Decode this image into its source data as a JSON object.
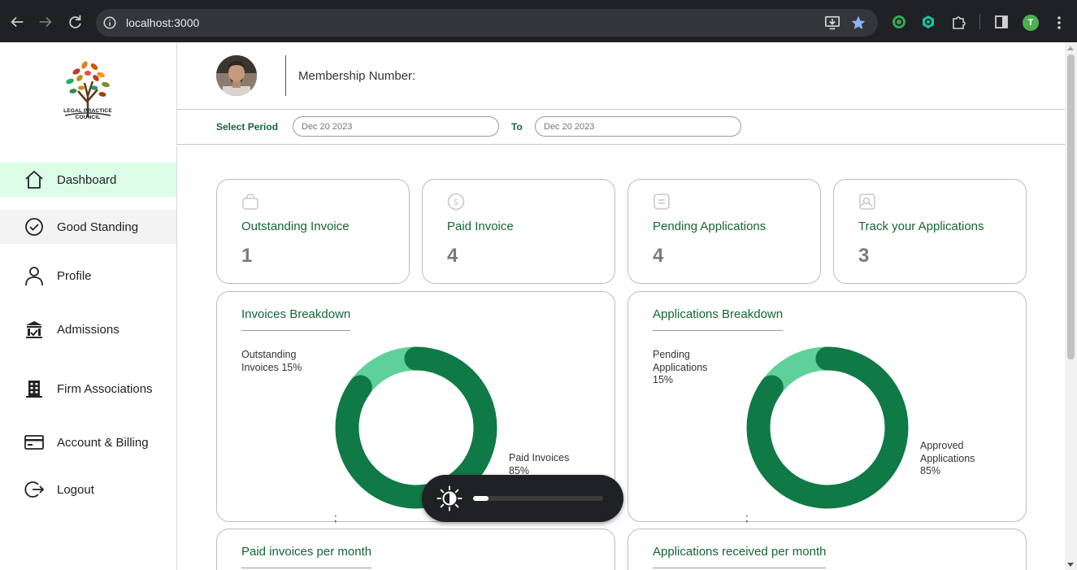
{
  "browser": {
    "url": "localhost:3000",
    "profile_initial": "T"
  },
  "sidebar": {
    "logo_text": "LEGAL PRACTICE COUNCIL",
    "items": [
      {
        "label": "Dashboard",
        "icon": "home-icon"
      },
      {
        "label": "Good Standing",
        "icon": "check-circle-icon"
      },
      {
        "label": "Profile",
        "icon": "user-icon"
      },
      {
        "label": "Admissions",
        "icon": "building-icon"
      },
      {
        "label": "Firm Associations",
        "icon": "office-building-icon"
      },
      {
        "label": "Account & Billing",
        "icon": "credit-card-icon"
      },
      {
        "label": "Logout",
        "icon": "logout-icon"
      }
    ]
  },
  "header": {
    "membership_label": "Membership Number:"
  },
  "period": {
    "select_label": "Select Period",
    "to_label": "To",
    "from_placeholder": "Dec 20 2023",
    "to_placeholder": "Dec 20 2023"
  },
  "stats": [
    {
      "title": "Outstanding Invoice",
      "value": "1",
      "icon": "bag-icon"
    },
    {
      "title": "Paid Invoice",
      "value": "4",
      "icon": "dollar-icon"
    },
    {
      "title": "Pending Applications",
      "value": "4",
      "icon": "document-icon"
    },
    {
      "title": "Track your Applications",
      "value": "3",
      "icon": "image-search-icon"
    }
  ],
  "invoices_panel": {
    "title": "Invoices Breakdown",
    "label_a_line1": "Outstanding",
    "label_a_line2": "Invoices 15%",
    "label_b_line1": "Paid Invoices",
    "label_b_line2": "85%",
    "stray": ";"
  },
  "applications_panel": {
    "title": "Applications Breakdown",
    "label_a_line1": "Pending",
    "label_a_line2": "Applications",
    "label_a_line3": "15%",
    "label_b_line1": "Approved",
    "label_b_line2": "Applications",
    "label_b_line3": "85%",
    "stray": ";"
  },
  "bottom_panels": {
    "paid_title": "Paid invoices per month",
    "received_title": "Applications received per month"
  },
  "brightness": {
    "level": 0.12
  },
  "colors": {
    "brand_green": "#166534",
    "donut_dark": "#0f7a45",
    "donut_light": "#5fd09a",
    "active_bg": "#dcfce7"
  },
  "chart_data": [
    {
      "type": "pie",
      "title": "Invoices Breakdown",
      "categories": [
        "Outstanding Invoices",
        "Paid Invoices"
      ],
      "values": [
        15,
        85
      ]
    },
    {
      "type": "pie",
      "title": "Applications Breakdown",
      "categories": [
        "Pending Applications",
        "Approved Applications"
      ],
      "values": [
        15,
        85
      ]
    }
  ]
}
